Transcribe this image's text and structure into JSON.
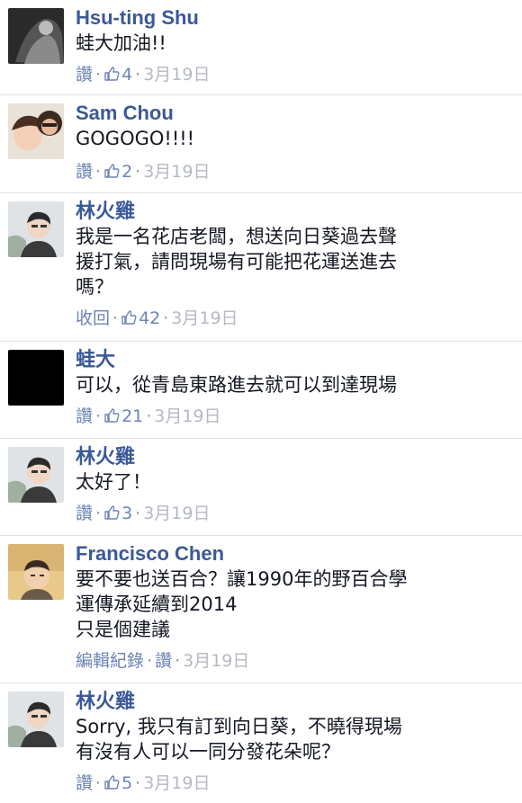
{
  "comments": [
    {
      "name": "Hsu-ting Shu",
      "text": "蛙大加油!!",
      "action": "讚",
      "likes": "4",
      "date": "3月19日"
    },
    {
      "name": "Sam Chou",
      "text": "GOGOGO!!!!",
      "action": "讚",
      "likes": "2",
      "date": "3月19日"
    },
    {
      "name": "林火雞",
      "text": "我是一名花店老闆，想送向日葵過去聲\n援打氣，請問現場有可能把花運送進去\n嗎？",
      "action": "收回",
      "likes": "42",
      "date": "3月19日"
    },
    {
      "name": "蛙大",
      "text": "可以，從青島東路進去就可以到達現場",
      "action": "讚",
      "likes": "21",
      "date": "3月19日"
    },
    {
      "name": "林火雞",
      "text": "太好了！",
      "action": "讚",
      "likes": "3",
      "date": "3月19日"
    },
    {
      "name": "Francisco Chen",
      "text": "要不要也送百合？讓1990年的野百合學\n運傳承延續到2014\n只是個建議",
      "edit_history": "編輯紀錄",
      "action": "讚",
      "date": "3月19日"
    },
    {
      "name": "林火雞",
      "text": "Sorry, 我只有訂到向日葵，不曉得現場\n有沒有人可以一同分發花朵呢？",
      "action": "讚",
      "likes": "5",
      "date": "3月19日"
    }
  ]
}
